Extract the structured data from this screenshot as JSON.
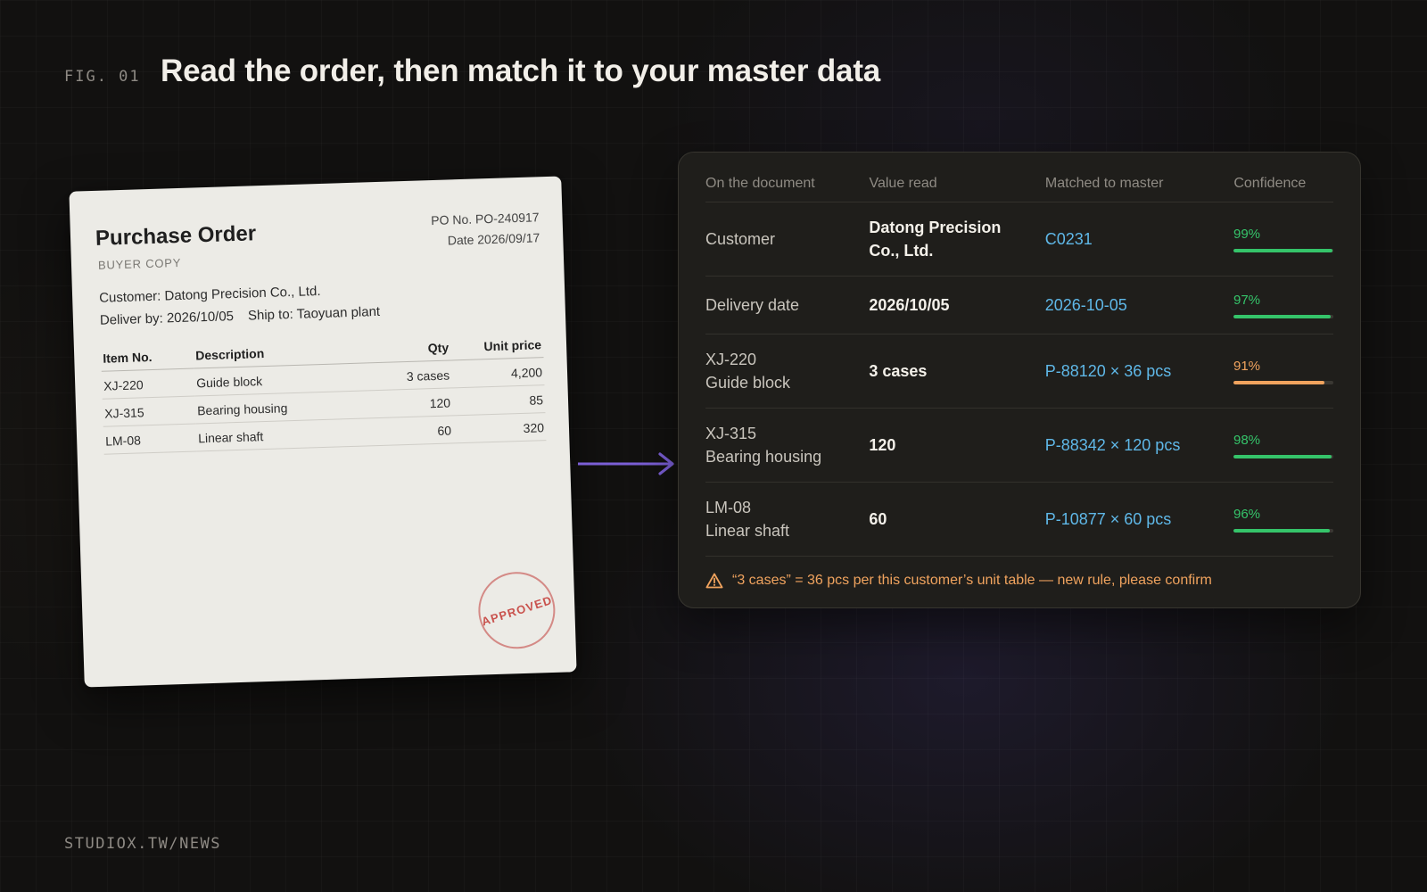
{
  "header": {
    "fig_label": "FIG. 01",
    "title": "Read the order, then match it to your master data"
  },
  "footer": {
    "text": "STUDIOX.TW/NEWS"
  },
  "document": {
    "title": "Purchase Order",
    "copy_label": "BUYER COPY",
    "po_number": "PO No. PO-240917",
    "date": "Date 2026/09/17",
    "customer": "Customer: Datong Precision Co., Ltd.",
    "deliver_by": "Deliver by: 2026/10/05",
    "ship_to": "Ship to: Taoyuan plant",
    "columns": [
      "Item No.",
      "Description",
      "Qty",
      "Unit price"
    ],
    "rows": [
      {
        "item": "XJ-220",
        "description": "Guide block",
        "qty": "3 cases",
        "price": "4,200"
      },
      {
        "item": "XJ-315",
        "description": "Bearing housing",
        "qty": "120",
        "price": "85"
      },
      {
        "item": "LM-08",
        "description": "Linear shaft",
        "qty": "60",
        "price": "320"
      }
    ],
    "stamp": "APPROVED"
  },
  "match_table": {
    "columns": [
      "On the document",
      "Value read",
      "Matched to master",
      "Confidence"
    ],
    "rows": [
      {
        "doc_line1": "Customer",
        "doc_line2": "",
        "value_line1": "Datong Precision",
        "value_line2": "Co., Ltd.",
        "matched": "C0231",
        "confidence": 99,
        "confidence_label": "99%",
        "status_color": "#35c46a"
      },
      {
        "doc_line1": "Delivery date",
        "doc_line2": "",
        "value_line1": "2026/10/05",
        "value_line2": "",
        "matched": "2026-10-05",
        "confidence": 97,
        "confidence_label": "97%",
        "status_color": "#35c46a"
      },
      {
        "doc_line1": "XJ-220",
        "doc_line2": "Guide block",
        "value_line1": "3 cases",
        "value_line2": "",
        "matched": "P-88120 × 36 pcs",
        "confidence": 91,
        "confidence_label": "91%",
        "status_color": "#f0a35e"
      },
      {
        "doc_line1": "XJ-315",
        "doc_line2": "Bearing housing",
        "value_line1": "120",
        "value_line2": "",
        "matched": "P-88342 × 120 pcs",
        "confidence": 98,
        "confidence_label": "98%",
        "status_color": "#35c46a"
      },
      {
        "doc_line1": "LM-08",
        "doc_line2": "Linear shaft",
        "value_line1": "60",
        "value_line2": "",
        "matched": "P-10877 × 60 pcs",
        "confidence": 96,
        "confidence_label": "96%",
        "status_color": "#35c46a"
      }
    ],
    "note_icon": "warning-icon",
    "note": "“3 cases” = 36 pcs per this customer’s unit table — new rule, please confirm"
  },
  "colors": {
    "accent_arrow": "#7b5fd6",
    "match_link": "#5fb8e8",
    "ok": "#35c46a",
    "warn": "#f0a35e"
  }
}
